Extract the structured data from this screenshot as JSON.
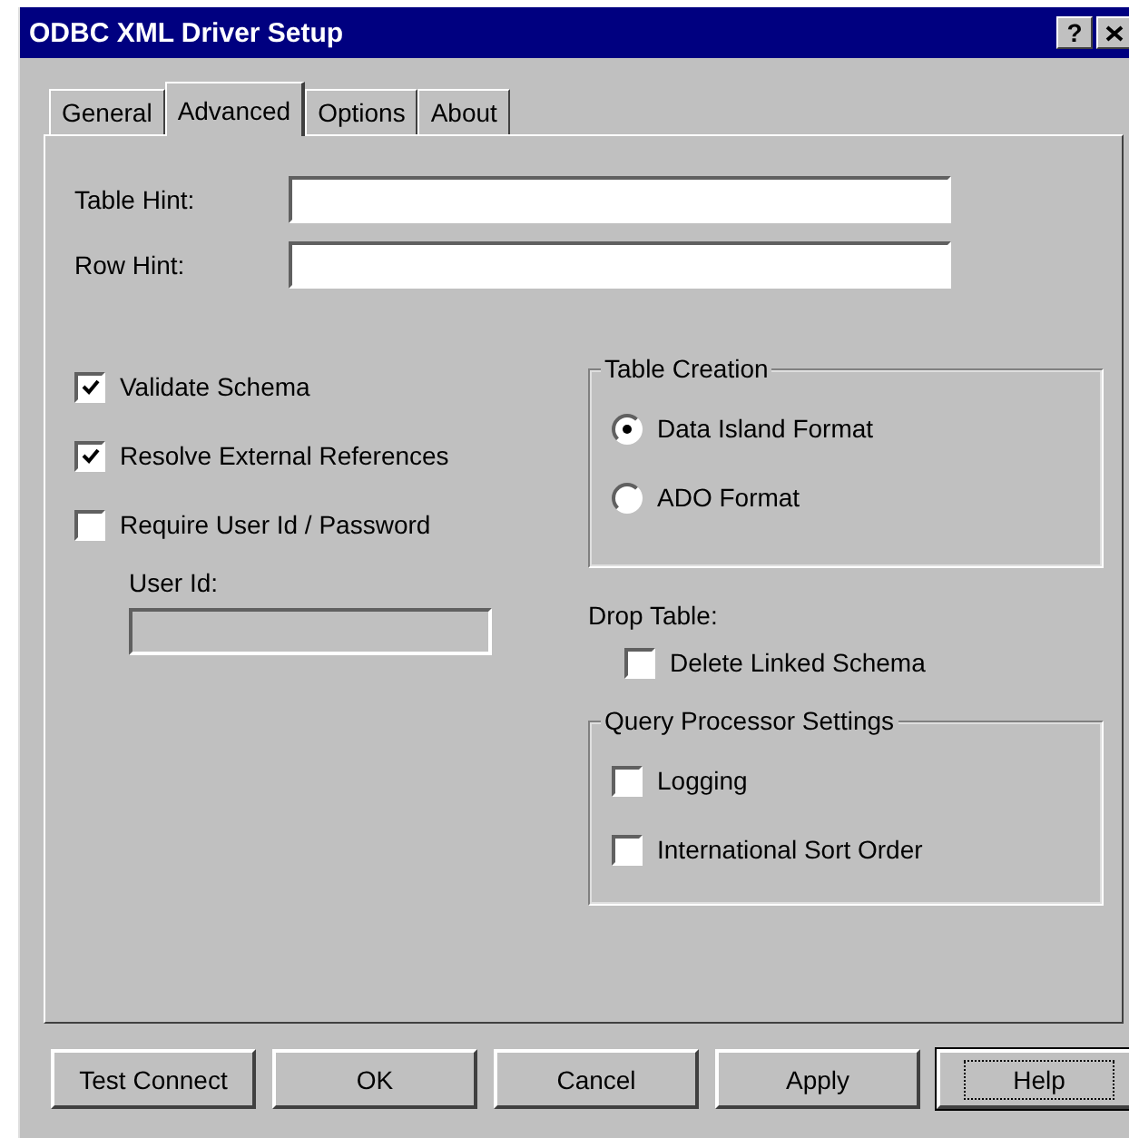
{
  "window": {
    "title": "ODBC XML Driver Setup",
    "help_button": "?"
  },
  "tabs": [
    {
      "label": "General",
      "selected": false
    },
    {
      "label": "Advanced",
      "selected": true
    },
    {
      "label": "Options",
      "selected": false
    },
    {
      "label": "About",
      "selected": false
    }
  ],
  "hints": [
    {
      "label": "Table Hint:"
    },
    {
      "label": "Row Hint:"
    }
  ],
  "options": [
    {
      "label": "Validate Schema",
      "checked": true
    },
    {
      "label": "Resolve External References",
      "checked": true
    },
    {
      "label": "Require User Id / Password",
      "checked": false
    }
  ],
  "user_id": {
    "label": "User Id:",
    "disabled": true
  },
  "table_creation": {
    "title": "Table Creation",
    "choices": [
      {
        "label": "Data Island Format",
        "selected": true
      },
      {
        "label": "ADO Format",
        "selected": false
      }
    ]
  },
  "drop_table": {
    "label": "Drop Table:",
    "option": {
      "label": "Delete Linked Schema",
      "checked": false
    }
  },
  "query_processor": {
    "title": "Query Processor Settings",
    "options": [
      {
        "label": "Logging",
        "checked": false
      },
      {
        "label": "International Sort Order",
        "checked": false
      }
    ]
  },
  "buttons": [
    {
      "label": "Test Connect",
      "default": false
    },
    {
      "label": "OK",
      "default": false
    },
    {
      "label": "Cancel",
      "default": false
    },
    {
      "label": "Apply",
      "default": false
    },
    {
      "label": "Help",
      "default": true
    }
  ]
}
